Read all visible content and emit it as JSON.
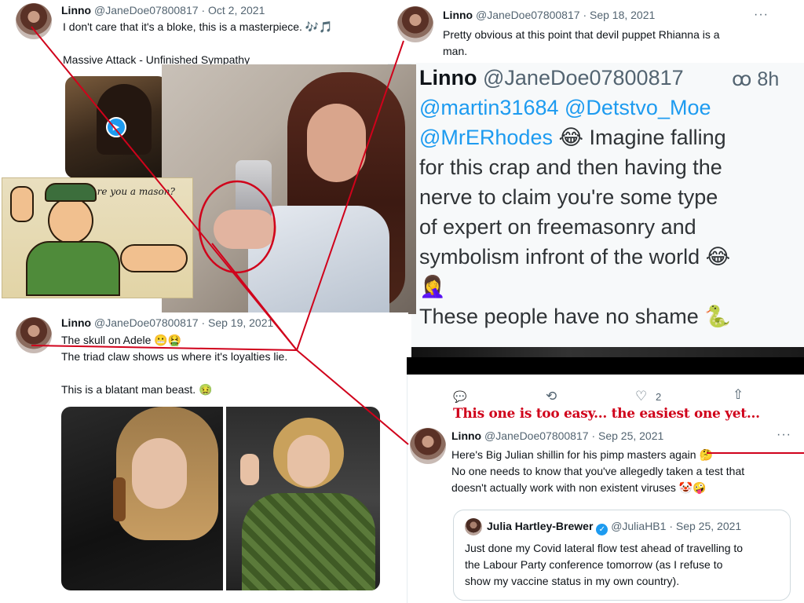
{
  "tweet_top_left": {
    "name": "Linno",
    "handle": "@JaneDoe07800817",
    "date": "· Oct 2, 2021",
    "line1": "I don't care that it's a bloke, this is a masterpiece. ",
    "line1_emoji": "🎶🎵",
    "line3": "Massive Attack - Unfinished Sympathy"
  },
  "tweet_top_right": {
    "name": "Linno",
    "handle": "@JaneDoe07800817",
    "date": "· Sep 18, 2021",
    "more": "···",
    "line1": "Pretty obvious at this point that devil puppet Rhianna is a",
    "line2": "man."
  },
  "zoomed_tweet": {
    "name": "Linno",
    "handle": "@JaneDoe07800817",
    "time": "8h",
    "lines": [
      {
        "mention": "@martin31684 @Detstvo_Moe",
        "text": ""
      },
      {
        "mention": "@MrERhodes",
        "text": " 😂 Imagine falling"
      },
      {
        "mention": "",
        "text": "for this crap and then having the"
      },
      {
        "mention": "",
        "text": "nerve to claim you're some type"
      },
      {
        "mention": "",
        "text": "of expert on freemasonry and"
      },
      {
        "mention": "",
        "text": "symbolism infront of the world 😂"
      },
      {
        "mention": "",
        "text": "🤦‍♀️"
      },
      {
        "mention": "",
        "text": "These people have no shame 🐍"
      }
    ]
  },
  "cartoon": {
    "speech": "Are you a mason?"
  },
  "tweet_adele": {
    "name": "Linno",
    "handle": "@JaneDoe07800817",
    "date": "· Sep 19, 2021",
    "line1": "The skull on Adele 😬🤮",
    "line2": "The triad claw shows us where it's loyalties lie.",
    "line4": "This is a blatant man beast. 🤢"
  },
  "tweet_bottom_right": {
    "actions": {
      "reply": "💬",
      "retweet": "⟲",
      "like": "♡",
      "like_count": "2",
      "share": "⇧"
    },
    "caption": "This one is too easy... the easiest one yet...",
    "name": "Linno",
    "handle": "@JaneDoe07800817",
    "date": "· Sep 25, 2021",
    "more": "···",
    "line1": "Here's Big Julian shillin for his pimp masters again 🤔",
    "line2": "No one needs to know that you've allegedly taken a test that",
    "line3": "doesn't actually work with non existent viruses 🤡🤪"
  },
  "quoted_tweet": {
    "name": "Julia Hartley-Brewer",
    "verified": "✓",
    "handle": "@JuliaHB1",
    "date": "· Sep 25, 2021",
    "line1": "Just done my Covid lateral flow test ahead of travelling to",
    "line2": "the Labour Party conference tomorrow (as I refuse to",
    "line3": "show my vaccine status in my own country)."
  },
  "colors": {
    "accent": "#1d9bf0",
    "annotation_red": "#d0021b",
    "text": "#0f1419",
    "muted": "#536471"
  }
}
